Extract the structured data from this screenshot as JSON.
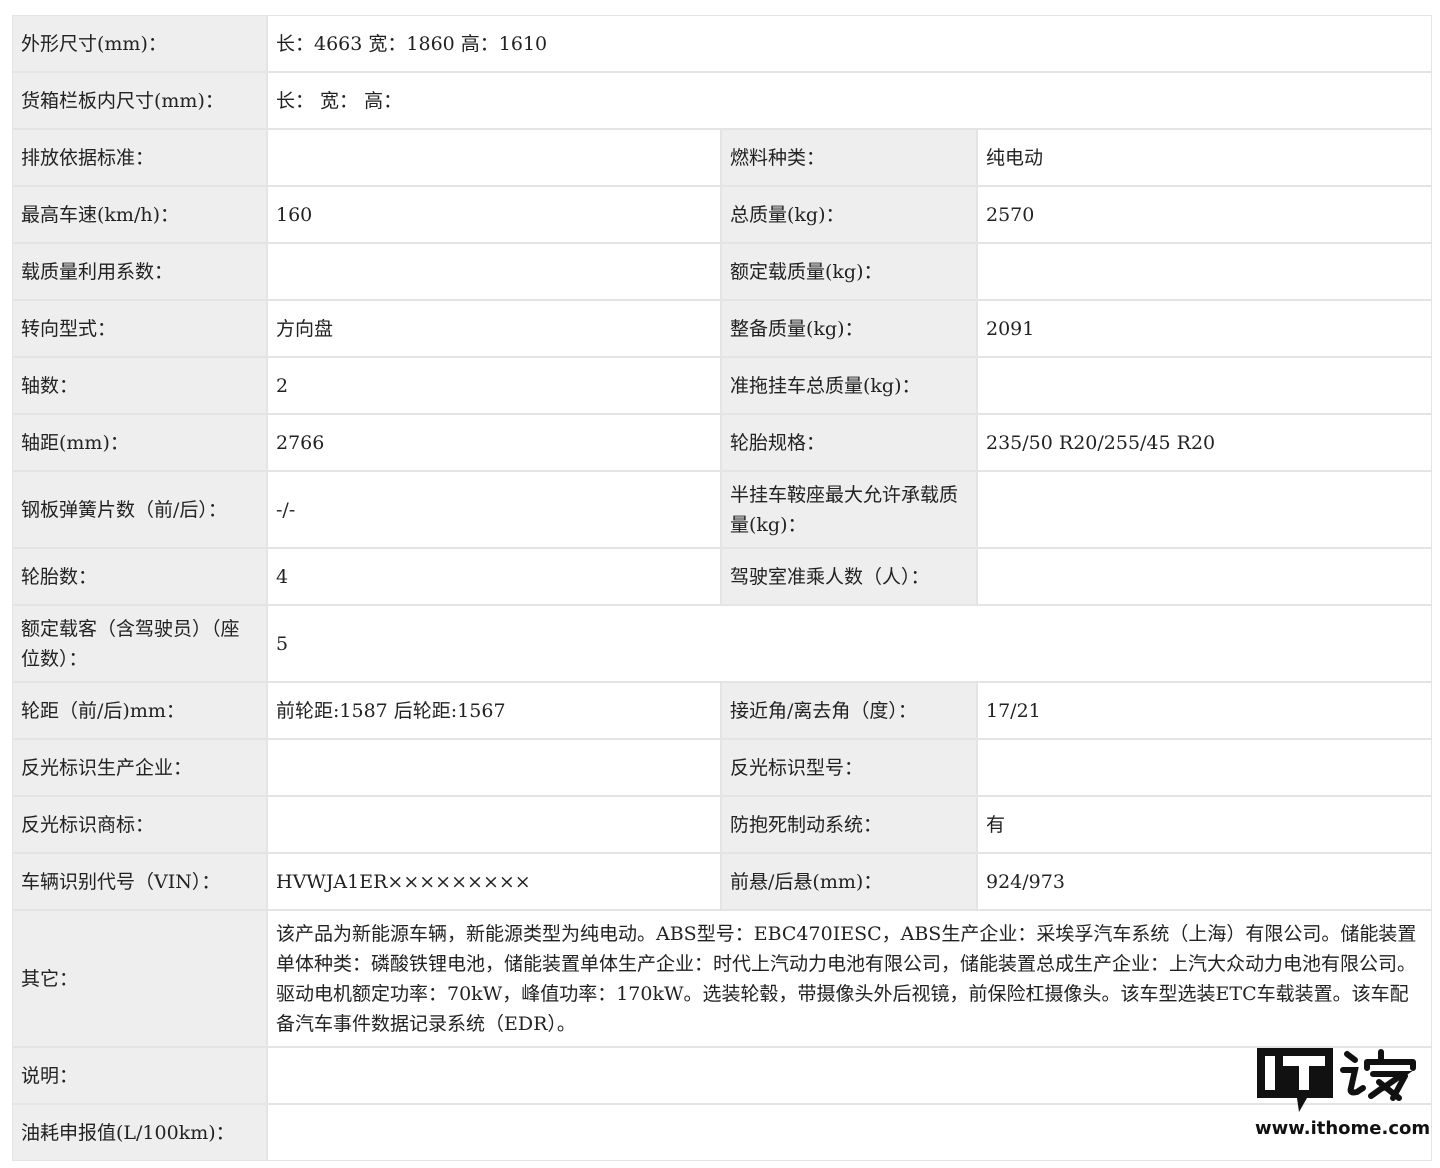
{
  "rows": [
    {
      "l1": "外形尺寸(mm)：",
      "v1": "长：4663 宽：1860 高：1610"
    },
    {
      "l1": "货箱栏板内尺寸(mm)：",
      "v1": "长： 宽： 高："
    },
    {
      "l1": "排放依据标准：",
      "v1": "",
      "l2": "燃料种类：",
      "v2": "纯电动"
    },
    {
      "l1": "最高车速(km/h)：",
      "v1": "160",
      "l2": "总质量(kg)：",
      "v2": "2570"
    },
    {
      "l1": "载质量利用系数：",
      "v1": "",
      "l2": "额定载质量(kg)：",
      "v2": ""
    },
    {
      "l1": "转向型式：",
      "v1": "方向盘",
      "l2": "整备质量(kg)：",
      "v2": "2091"
    },
    {
      "l1": "轴数：",
      "v1": "2",
      "l2": "准拖挂车总质量(kg)：",
      "v2": ""
    },
    {
      "l1": "轴距(mm)：",
      "v1": "2766",
      "l2": "轮胎规格：",
      "v2": "235/50 R20/255/45 R20"
    },
    {
      "l1": "钢板弹簧片数（前/后）：",
      "v1": "-/-",
      "l2": "半挂车鞍座最大允许承载质量(kg)：",
      "v2": ""
    },
    {
      "l1": "轮胎数：",
      "v1": "4",
      "l2": "驾驶室准乘人数（人）：",
      "v2": ""
    },
    {
      "l1": "额定载客（含驾驶员）（座位数）：",
      "v1": "5"
    },
    {
      "l1": "轮距（前/后)mm：",
      "v1": "前轮距:1587 后轮距:1567",
      "l2": "接近角/离去角（度）：",
      "v2": "17/21"
    },
    {
      "l1": "反光标识生产企业：",
      "v1": "",
      "l2": "反光标识型号：",
      "v2": ""
    },
    {
      "l1": "反光标识商标：",
      "v1": "",
      "l2": "防抱死制动系统：",
      "v2": "有"
    },
    {
      "l1": "车辆识别代号（VIN）：",
      "v1": "HVWJA1ER×××××××××",
      "l2": "前悬/后悬(mm)：",
      "v2": "924/973"
    },
    {
      "l1": "其它：",
      "v1": "该产品为新能源车辆，新能源类型为纯电动。ABS型号：EBC470IESC，ABS生产企业：采埃孚汽车系统（上海）有限公司。储能装置单体种类：磷酸铁锂电池，储能装置单体生产企业：时代上汽动力电池有限公司，储能装置总成生产企业：上汽大众动力电池有限公司。驱动电机额定功率：70kW，峰值功率：170kW。选装轮毂，带摄像头外后视镜，前保险杠摄像头。该车型选装ETC车载装置。该车配备汽车事件数据记录系统（EDR）。"
    },
    {
      "l1": "说明：",
      "v1": ""
    },
    {
      "l1": "油耗申报值(L/100km)：",
      "v1": ""
    }
  ],
  "watermark": {
    "logo": "IT之家",
    "url": "www.ithome.com",
    "icon": "ithome-logo-icon"
  }
}
